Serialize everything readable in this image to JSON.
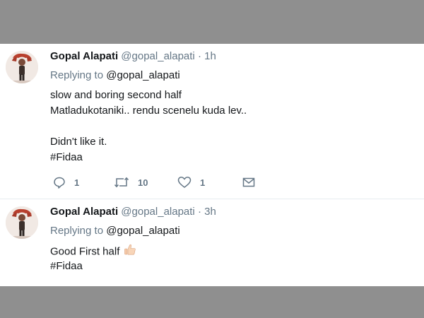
{
  "tweets": [
    {
      "name": "Gopal Alapati",
      "handle": "@gopal_alapati",
      "dot": "·",
      "time": "1h",
      "replying_prefix": "Replying to",
      "replying_to": "@gopal_alapati",
      "lines": [
        "slow and boring second half",
        "Matladukotaniki.. rendu scenelu kuda lev..",
        "",
        "Didn't like it.",
        "#Fidaa"
      ],
      "replies": "1",
      "retweets": "10",
      "likes": "1"
    },
    {
      "name": "Gopal Alapati",
      "handle": "@gopal_alapati",
      "dot": "·",
      "time": "3h",
      "replying_prefix": "Replying to",
      "replying_to": "@gopal_alapati",
      "lines": [
        "Good First half",
        "#Fidaa"
      ],
      "emoji": "thumbs-up"
    }
  ],
  "icons": {
    "reply": "reply-icon",
    "retweet": "retweet-icon",
    "like": "heart-icon",
    "message": "envelope-icon"
  },
  "colors": {
    "overlay": "#8f8f8f",
    "secondary_text": "#657786",
    "divider": "#e6ecf0"
  }
}
